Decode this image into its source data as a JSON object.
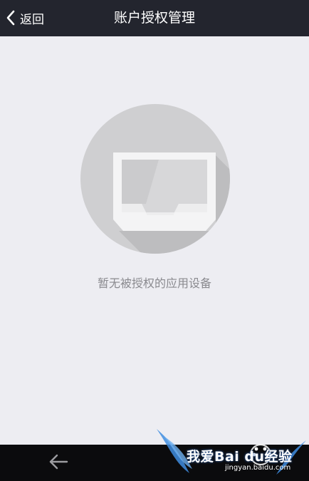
{
  "header": {
    "back_label": "返回",
    "title": "账户授权管理"
  },
  "empty_state": {
    "icon": "inbox-tray-icon",
    "message": "暂无被授权的应用设备"
  },
  "navigation_bar": {
    "back_icon": "arrow-left-icon"
  },
  "watermark": {
    "main_text": "我爱Bai du经验",
    "url": "jingyan.baidu.com"
  },
  "colors": {
    "header_bg": "#23252e",
    "page_bg": "#ededf2",
    "circle": "#cfcfd1",
    "navbar_bg": "#0b0b0d",
    "message_text": "#8a8a8f"
  }
}
